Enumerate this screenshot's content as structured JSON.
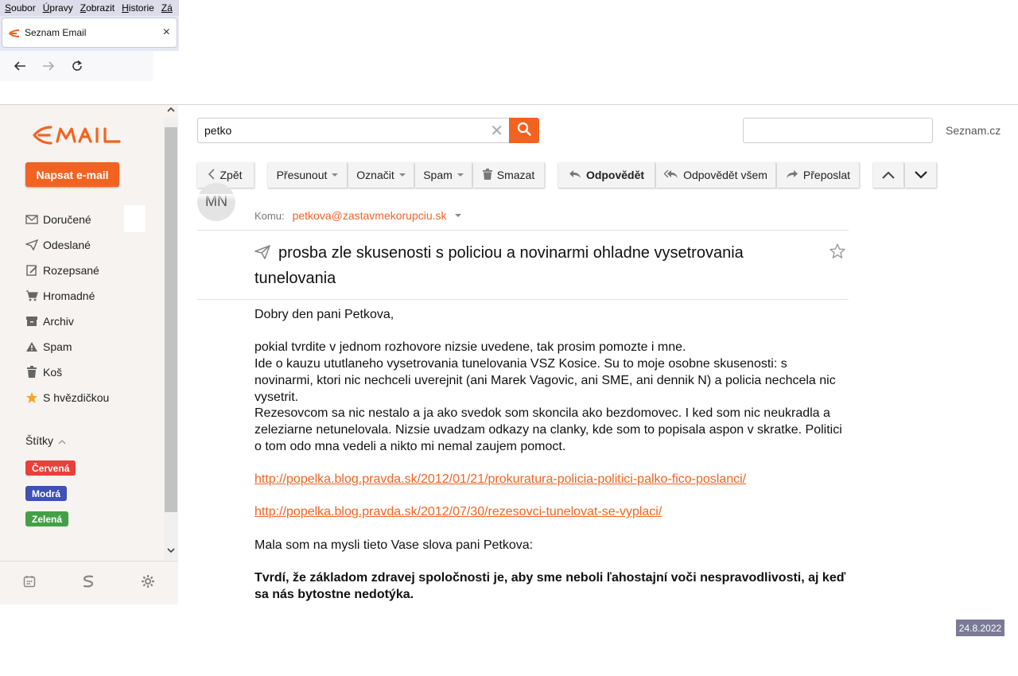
{
  "browser": {
    "menu": [
      {
        "u": "S",
        "rest": "oubor"
      },
      {
        "u": "Ú",
        "rest": "pravy"
      },
      {
        "u": "Z",
        "rest": "obrazit"
      },
      {
        "u": "H",
        "rest": "istorie"
      },
      {
        "u": "Zá",
        "rest": ""
      }
    ],
    "tab_title": "Seznam Email",
    "tab_close": "×"
  },
  "search": {
    "value": "petko",
    "clear": "✕"
  },
  "header": {
    "seznam_link": "Seznam.cz"
  },
  "sidebar": {
    "compose_label": "Napsat e-mail",
    "folders": [
      {
        "label": "Doručené",
        "icon": "envelope-icon"
      },
      {
        "label": "Odeslané",
        "icon": "send-icon"
      },
      {
        "label": "Rozepsané",
        "icon": "draft-icon"
      },
      {
        "label": "Hromadné",
        "icon": "cart-icon"
      },
      {
        "label": "Archiv",
        "icon": "archive-icon"
      },
      {
        "label": "Spam",
        "icon": "warning-icon"
      },
      {
        "label": "Koš",
        "icon": "trash-icon"
      },
      {
        "label": "S hvězdičkou",
        "icon": "star-icon"
      }
    ],
    "labels_title": "Štítky",
    "labels": [
      {
        "label": "Červená",
        "color": "#e8403a"
      },
      {
        "label": "Modrá",
        "color": "#3f51b5"
      },
      {
        "label": "Zelená",
        "color": "#43a047"
      }
    ]
  },
  "toolbar": {
    "back": "Zpět",
    "move": "Přesunout",
    "mark": "Označit",
    "spam": "Spam",
    "delete": "Smazat",
    "reply": "Odpovědět",
    "reply_all": "Odpovědět všem",
    "forward": "Přeposlat"
  },
  "message": {
    "avatar_initials": "MN",
    "to_label": "Komu:",
    "to_address": "petkova@zastavmekorupciu.sk",
    "subject": "prosba zle skusenosti s policiou a novinarmi ohladne vysetrovania tunelovania",
    "greeting": "Dobry den pani Petkova,",
    "p1": "pokial tvrdite v jednom rozhovore nizsie uvedene, tak prosim pomozte i mne.",
    "p2": "Ide o kauzu ututlaneho vysetrovania tunelovania VSZ Kosice. Su to moje osobne skusenosti: s novinarmi, ktori nic nechceli uverejnit (ani Marek Vagovic, ani SME, ani dennik N) a policia nechcela nic vysetrit.",
    "p3": "Rezesovcom sa nic nestalo a ja ako svedok som skoncila ako bezdomovec. I ked som nic neukradla a zeleziarne netunelovala. Nizsie uvadzam odkazy na clanky, kde som to popisala aspon v skratke. Politici o tom odo mna vedeli a  nikto mi nemal zaujem pomoct.",
    "link1": "http://popelka.blog.pravda.sk/2012/01/21/prokuratura-policia-politici-palko-fico-poslanci/",
    "link2": "http://popelka.blog.pravda.sk/2012/07/30/rezesovci-tunelovat-se-vyplaci/",
    "p4": "Mala som na mysli tieto Vase slova pani Petkova:",
    "quote": "Tvrdí, že základom zdravej spoločnosti je, aby sme neboli ľahostajní voči nespravodlivosti, aj keď sa nás bytostne nedotýka."
  },
  "date_badge": "24.8.2022",
  "colors": {
    "accent": "#f26322"
  }
}
